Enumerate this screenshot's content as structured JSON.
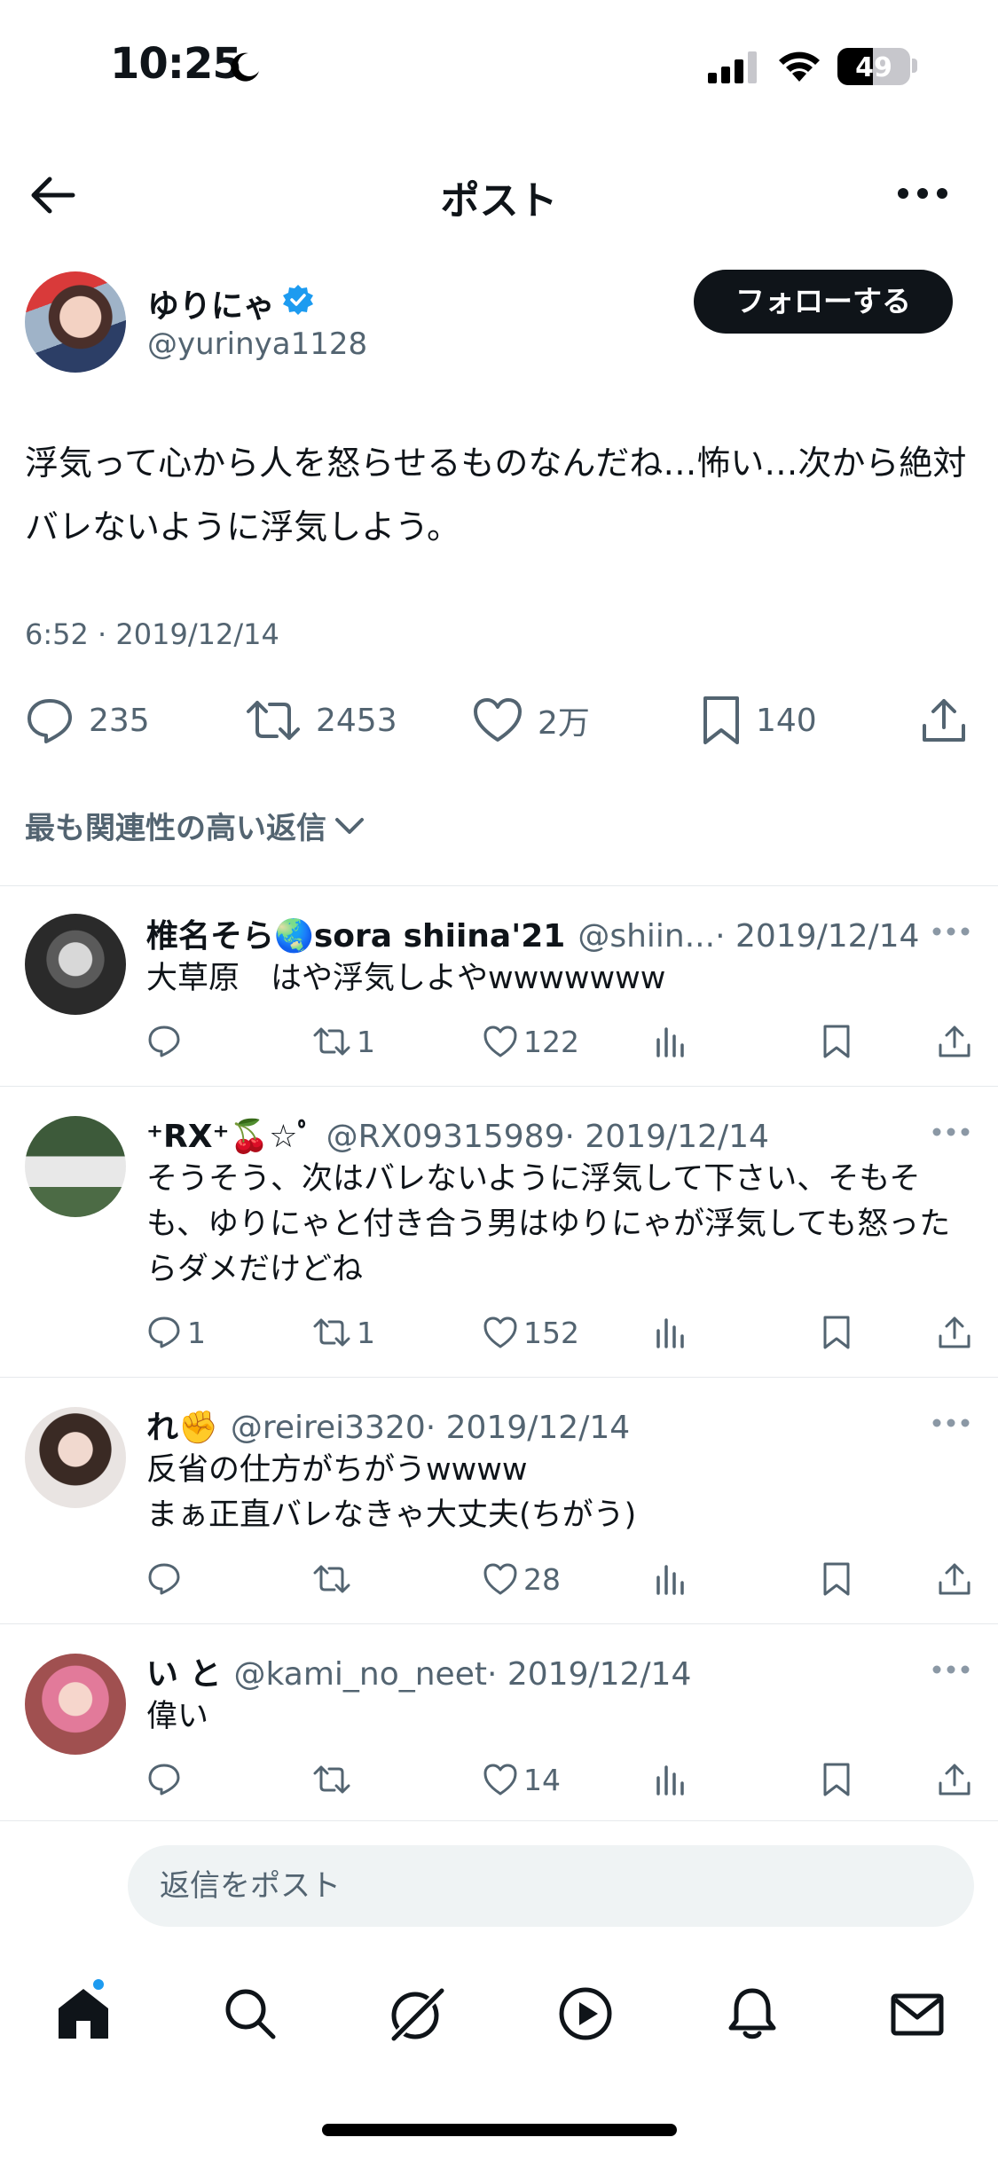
{
  "status_bar": {
    "time": "10:25",
    "battery": "49",
    "battery_level": 0.49
  },
  "header": {
    "title": "ポスト"
  },
  "post": {
    "author_name": "ゆりにゃ",
    "author_handle": "@yurinya1128",
    "follow_label": "フォローする",
    "text": "浮気って心から人を怒らせるものなんだね…怖い…次から絶対バレないように浮気しよう。",
    "timestamp": "6:52 · 2019/12/14",
    "stats": {
      "replies": "235",
      "reposts": "2453",
      "likes": "2万",
      "bookmarks": "140"
    },
    "sort_label": "最も関連性の高い返信"
  },
  "replies": [
    {
      "name": "椎名そら🌏sora shiina'21",
      "handle": "@shiin...",
      "date": " · 2019/12/14",
      "text": "大草原　はや浮気しよやwwwwwww",
      "replies": "",
      "reposts": "1",
      "likes": "122"
    },
    {
      "name": "⁺RX⁺🍒☆ﾟ",
      "handle": "@RX09315989",
      "date": " · 2019/12/14",
      "text": "そうそう、次はバレないように浮気して下さい、そもそも、ゆりにゃと付き合う男はゆりにゃが浮気しても怒ったらダメだけどね",
      "replies": "1",
      "reposts": "1",
      "likes": "152"
    },
    {
      "name": "れ✊",
      "handle": "@reirei3320",
      "date": " · 2019/12/14",
      "text": "反省の仕方がちがうwwww\nまぁ正直バレなきゃ大丈夫(ちがう)",
      "replies": "",
      "reposts": "",
      "likes": "28"
    },
    {
      "name": "い と",
      "handle": "@kami_no_neet",
      "date": " · 2019/12/14",
      "text": "偉い",
      "replies": "",
      "reposts": "",
      "likes": "14"
    }
  ],
  "reply_box": {
    "placeholder": "返信をポスト"
  },
  "tabbar": {
    "items": [
      "home-icon",
      "search-icon",
      "grok-icon",
      "video-icon",
      "notifications-icon",
      "messages-icon"
    ]
  },
  "colors": {
    "accent": "#1d9bf0",
    "text": "#0f1419",
    "secondary": "#536471",
    "badge": "#1d9bf0"
  }
}
